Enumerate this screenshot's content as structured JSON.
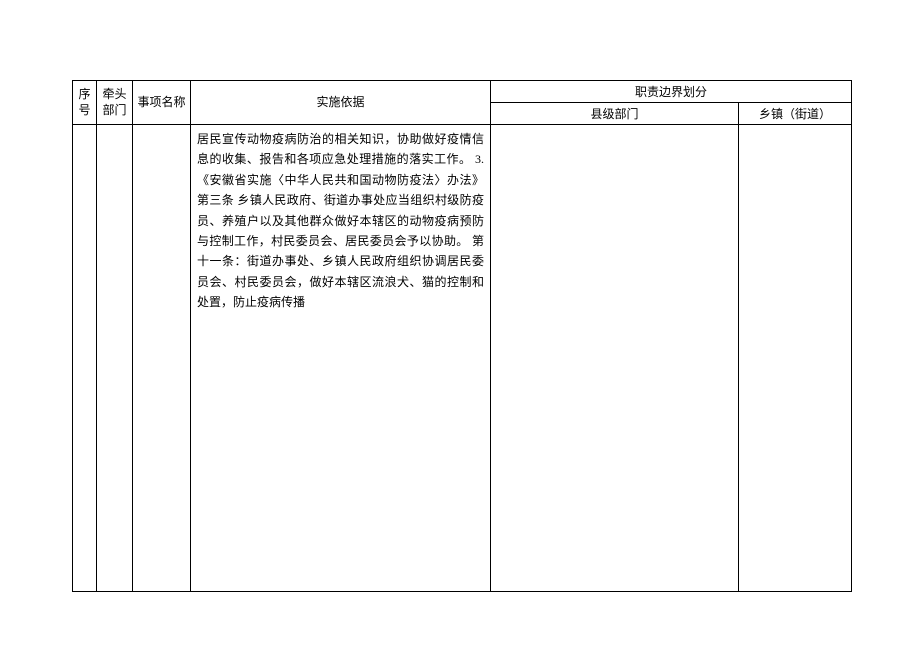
{
  "table": {
    "headers": {
      "seq": "序号",
      "lead_dept": "牵头部门",
      "item_name": "事项名称",
      "basis": "实施依据",
      "division": "职责边界划分",
      "county": "县级部门",
      "town": "乡镇（街道）"
    },
    "row": {
      "seq": "",
      "lead_dept": "",
      "item_name": "",
      "basis": "居民宣传动物疫病防治的相关知识，协助做好疫情信息的收集、报告和各项应急处理措施的落实工作。\n3.《安徽省实施〈中华人民共和国动物防疫法〉办法》第三条  乡镇人民政府、街道办事处应当组织村级防疫员、养殖户以及其他群众做好本辖区的动物疫病预防与控制工作，村民委员会、居民委员会予以协助。  第十一条：街道办事处、乡镇人民政府组织协调居民委员会、村民委员会，做好本辖区流浪犬、猫的控制和处置，防止疫病传播",
      "county": "",
      "town": ""
    }
  }
}
